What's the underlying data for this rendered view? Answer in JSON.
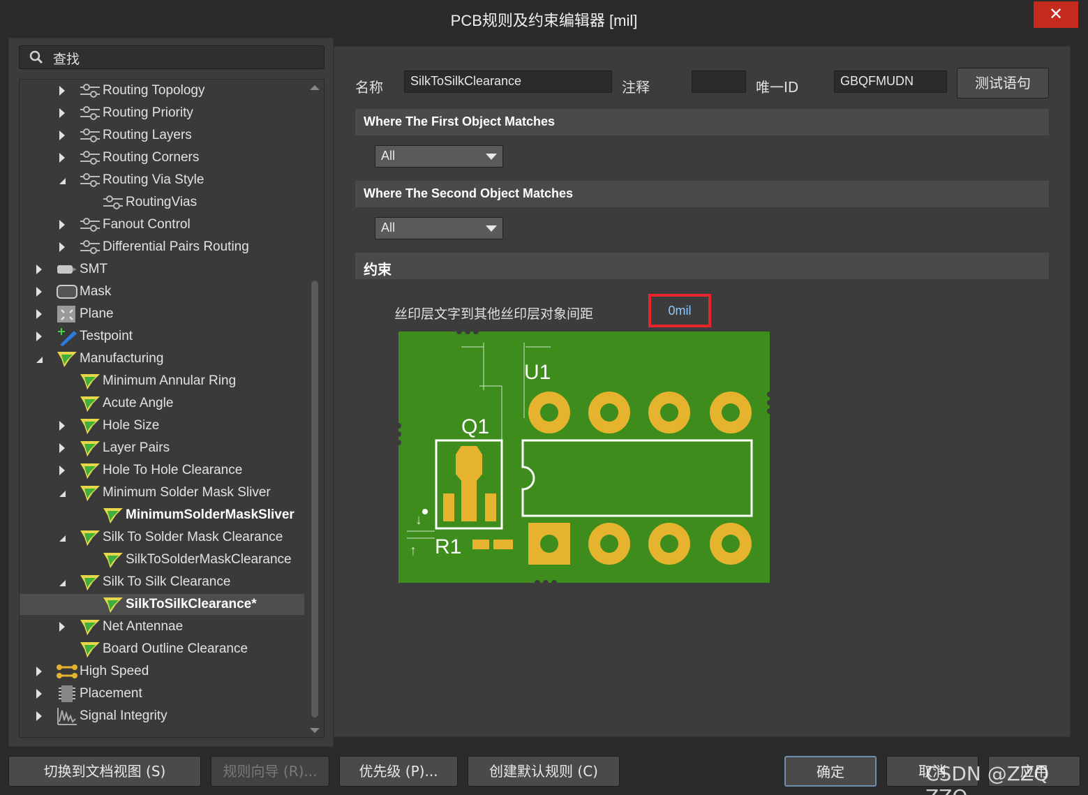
{
  "window": {
    "title": "PCB规则及约束编辑器 [mil]",
    "close_label": "✕"
  },
  "search": {
    "value": "查找"
  },
  "tree": [
    {
      "label": "Routing Topology",
      "icon": "routing-rule-icon",
      "arrow": "right"
    },
    {
      "label": "Routing Priority",
      "icon": "routing-rule-icon",
      "arrow": "right"
    },
    {
      "label": "Routing Layers",
      "icon": "routing-rule-icon",
      "arrow": "right"
    },
    {
      "label": "Routing Corners",
      "icon": "routing-rule-icon",
      "arrow": "right"
    },
    {
      "label": "Routing Via Style",
      "icon": "routing-rule-icon",
      "arrow": "down"
    },
    {
      "label": "RoutingVias",
      "icon": "routing-rule-icon",
      "arrow": "none"
    },
    {
      "label": "Fanout Control",
      "icon": "routing-rule-icon",
      "arrow": "right"
    },
    {
      "label": "Differential Pairs Routing",
      "icon": "routing-rule-icon",
      "arrow": "right"
    },
    {
      "label": "SMT",
      "icon": "smt-icon",
      "arrow": "right"
    },
    {
      "label": "Mask",
      "icon": "mask-icon",
      "arrow": "right"
    },
    {
      "label": "Plane",
      "icon": "plane-icon",
      "arrow": "right"
    },
    {
      "label": "Testpoint",
      "icon": "testpoint-icon",
      "arrow": "right"
    },
    {
      "label": "Manufacturing",
      "icon": "manufacturing-icon",
      "arrow": "down"
    },
    {
      "label": "Minimum Annular Ring",
      "icon": "manufacturing-icon",
      "arrow": "none"
    },
    {
      "label": "Acute Angle",
      "icon": "manufacturing-icon",
      "arrow": "none"
    },
    {
      "label": "Hole Size",
      "icon": "manufacturing-icon",
      "arrow": "right"
    },
    {
      "label": "Layer Pairs",
      "icon": "manufacturing-icon",
      "arrow": "right"
    },
    {
      "label": "Hole To Hole Clearance",
      "icon": "manufacturing-icon",
      "arrow": "right"
    },
    {
      "label": "Minimum Solder Mask Sliver",
      "icon": "manufacturing-icon",
      "arrow": "down"
    },
    {
      "label": "MinimumSolderMaskSliver",
      "icon": "manufacturing-icon",
      "arrow": "none"
    },
    {
      "label": "Silk To Solder Mask Clearance",
      "icon": "manufacturing-icon",
      "arrow": "down"
    },
    {
      "label": "SilkToSolderMaskClearance",
      "icon": "manufacturing-icon",
      "arrow": "none"
    },
    {
      "label": "Silk To Silk Clearance",
      "icon": "manufacturing-icon",
      "arrow": "down"
    },
    {
      "label": "SilkToSilkClearance*",
      "icon": "manufacturing-icon",
      "arrow": "none"
    },
    {
      "label": "Net Antennae",
      "icon": "manufacturing-icon",
      "arrow": "right"
    },
    {
      "label": "Board Outline Clearance",
      "icon": "manufacturing-icon",
      "arrow": "none"
    },
    {
      "label": "High Speed",
      "icon": "high-speed-icon",
      "arrow": "right"
    },
    {
      "label": "Placement",
      "icon": "placement-icon",
      "arrow": "right"
    },
    {
      "label": "Signal Integrity",
      "icon": "signal-integrity-icon",
      "arrow": "right"
    }
  ],
  "rule": {
    "name_label": "名称",
    "name_value": "SilkToSilkClearance",
    "comment_label": "注释",
    "comment_value": "",
    "uid_label": "唯一ID",
    "uid_value": "GBQFMUDN",
    "test_button": "测试语句"
  },
  "first_match": {
    "header": "Where The First Object Matches",
    "selected": "All"
  },
  "second_match": {
    "header": "Where The Second Object Matches",
    "selected": "All"
  },
  "constraints": {
    "header": "约束",
    "label": "丝印层文字到其他丝印层对象间距",
    "value": "0mil",
    "diagram_labels": {
      "u1": "U1",
      "q1": "Q1",
      "r1": "R1"
    },
    "colors": {
      "board": "#3d8c1c",
      "pad": "#e6b32e",
      "silk": "#ffffff",
      "highlight": "#e8252c"
    }
  },
  "buttons": {
    "switch_doc": "切换到文档视图 (S)",
    "wizard": "规则向导 (R)...",
    "priority": "优先级 (P)...",
    "create_default": "创建默认规则 (C)",
    "ok": "确定",
    "cancel": "取消",
    "apply": "应用"
  },
  "watermark": "CSDN @ZZQ ZZQ"
}
